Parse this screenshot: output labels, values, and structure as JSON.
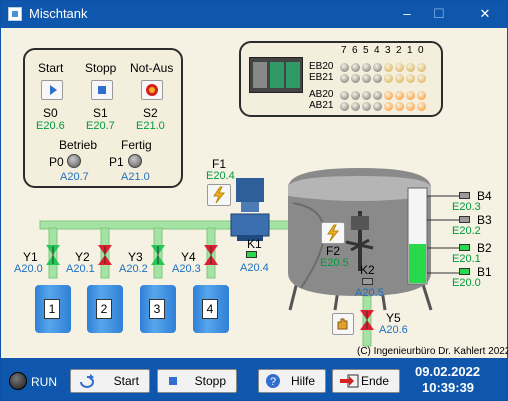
{
  "window": {
    "title": "Mischtank",
    "minimize": "–",
    "maximize": "☐",
    "close": "✕"
  },
  "control_panel": {
    "start": {
      "label": "Start",
      "id": "S0",
      "addr": "E20.6"
    },
    "stop": {
      "label": "Stopp",
      "id": "S1",
      "addr": "E20.7"
    },
    "estop": {
      "label": "Not-Aus",
      "id": "S2",
      "addr": "E21.0"
    },
    "betrieb": {
      "label": "Betrieb",
      "id": "P0",
      "addr": "A20.7"
    },
    "fertig": {
      "label": "Fertig",
      "id": "P1",
      "addr": "A21.0"
    }
  },
  "io_panel": {
    "bits": [
      "7",
      "6",
      "5",
      "4",
      "3",
      "2",
      "1",
      "0"
    ],
    "rows": [
      {
        "name": "EB20",
        "states": [
          0,
          0,
          0,
          0,
          0,
          0,
          0,
          0
        ]
      },
      {
        "name": "EB21",
        "states": [
          0,
          0,
          0,
          0,
          0,
          0,
          0,
          0
        ]
      },
      {
        "name": "AB20",
        "states": [
          0,
          0,
          0,
          0,
          0,
          0,
          0,
          0
        ]
      },
      {
        "name": "AB21",
        "states": [
          0,
          0,
          0,
          0,
          0,
          0,
          0,
          0
        ]
      }
    ],
    "colors": {
      "in_off": "#d8a840",
      "out_off": "#ff8c1a",
      "inactive": "#6e6e6e"
    }
  },
  "valves": [
    {
      "id": "Y1",
      "addr": "A20.0",
      "state": "open"
    },
    {
      "id": "Y2",
      "addr": "A20.1",
      "state": "closed"
    },
    {
      "id": "Y3",
      "addr": "A20.2",
      "state": "open"
    },
    {
      "id": "Y4",
      "addr": "A20.3",
      "state": "closed"
    }
  ],
  "barrels": [
    "1",
    "2",
    "3",
    "4"
  ],
  "pump": {
    "fuse_id": "F1",
    "fuse_addr": "E20.4",
    "motor_id": "K1",
    "motor_addr": "A20.4"
  },
  "mixer": {
    "fuse_id": "F2",
    "fuse_addr": "E20.5",
    "motor_id": "K2",
    "motor_addr": "A20.5"
  },
  "drain_valve": {
    "id": "Y5",
    "addr": "A20.6"
  },
  "sensors": [
    {
      "id": "B4",
      "addr": "E20.3",
      "state": "off"
    },
    {
      "id": "B3",
      "addr": "E20.2",
      "state": "off"
    },
    {
      "id": "B2",
      "addr": "E20.1",
      "state": "on"
    },
    {
      "id": "B1",
      "addr": "E20.0",
      "state": "on"
    }
  ],
  "tank": {
    "fill_level_fraction": 0.42
  },
  "copyright": "(C) Ingenieurbüro Dr. Kahlert 2022",
  "statusbar": {
    "run_label": "RUN",
    "buttons": {
      "start": "Start",
      "stop": "Stopp",
      "help": "Hilfe",
      "end": "Ende"
    },
    "date": "09.02.2022",
    "time": "10:39:39"
  },
  "colors": {
    "pipe": "#a5e3a5",
    "valve_open": "#22c755",
    "valve_closed": "#dd1f2f",
    "water": "#2f7fd6",
    "sensor_on": "#29d94c"
  }
}
